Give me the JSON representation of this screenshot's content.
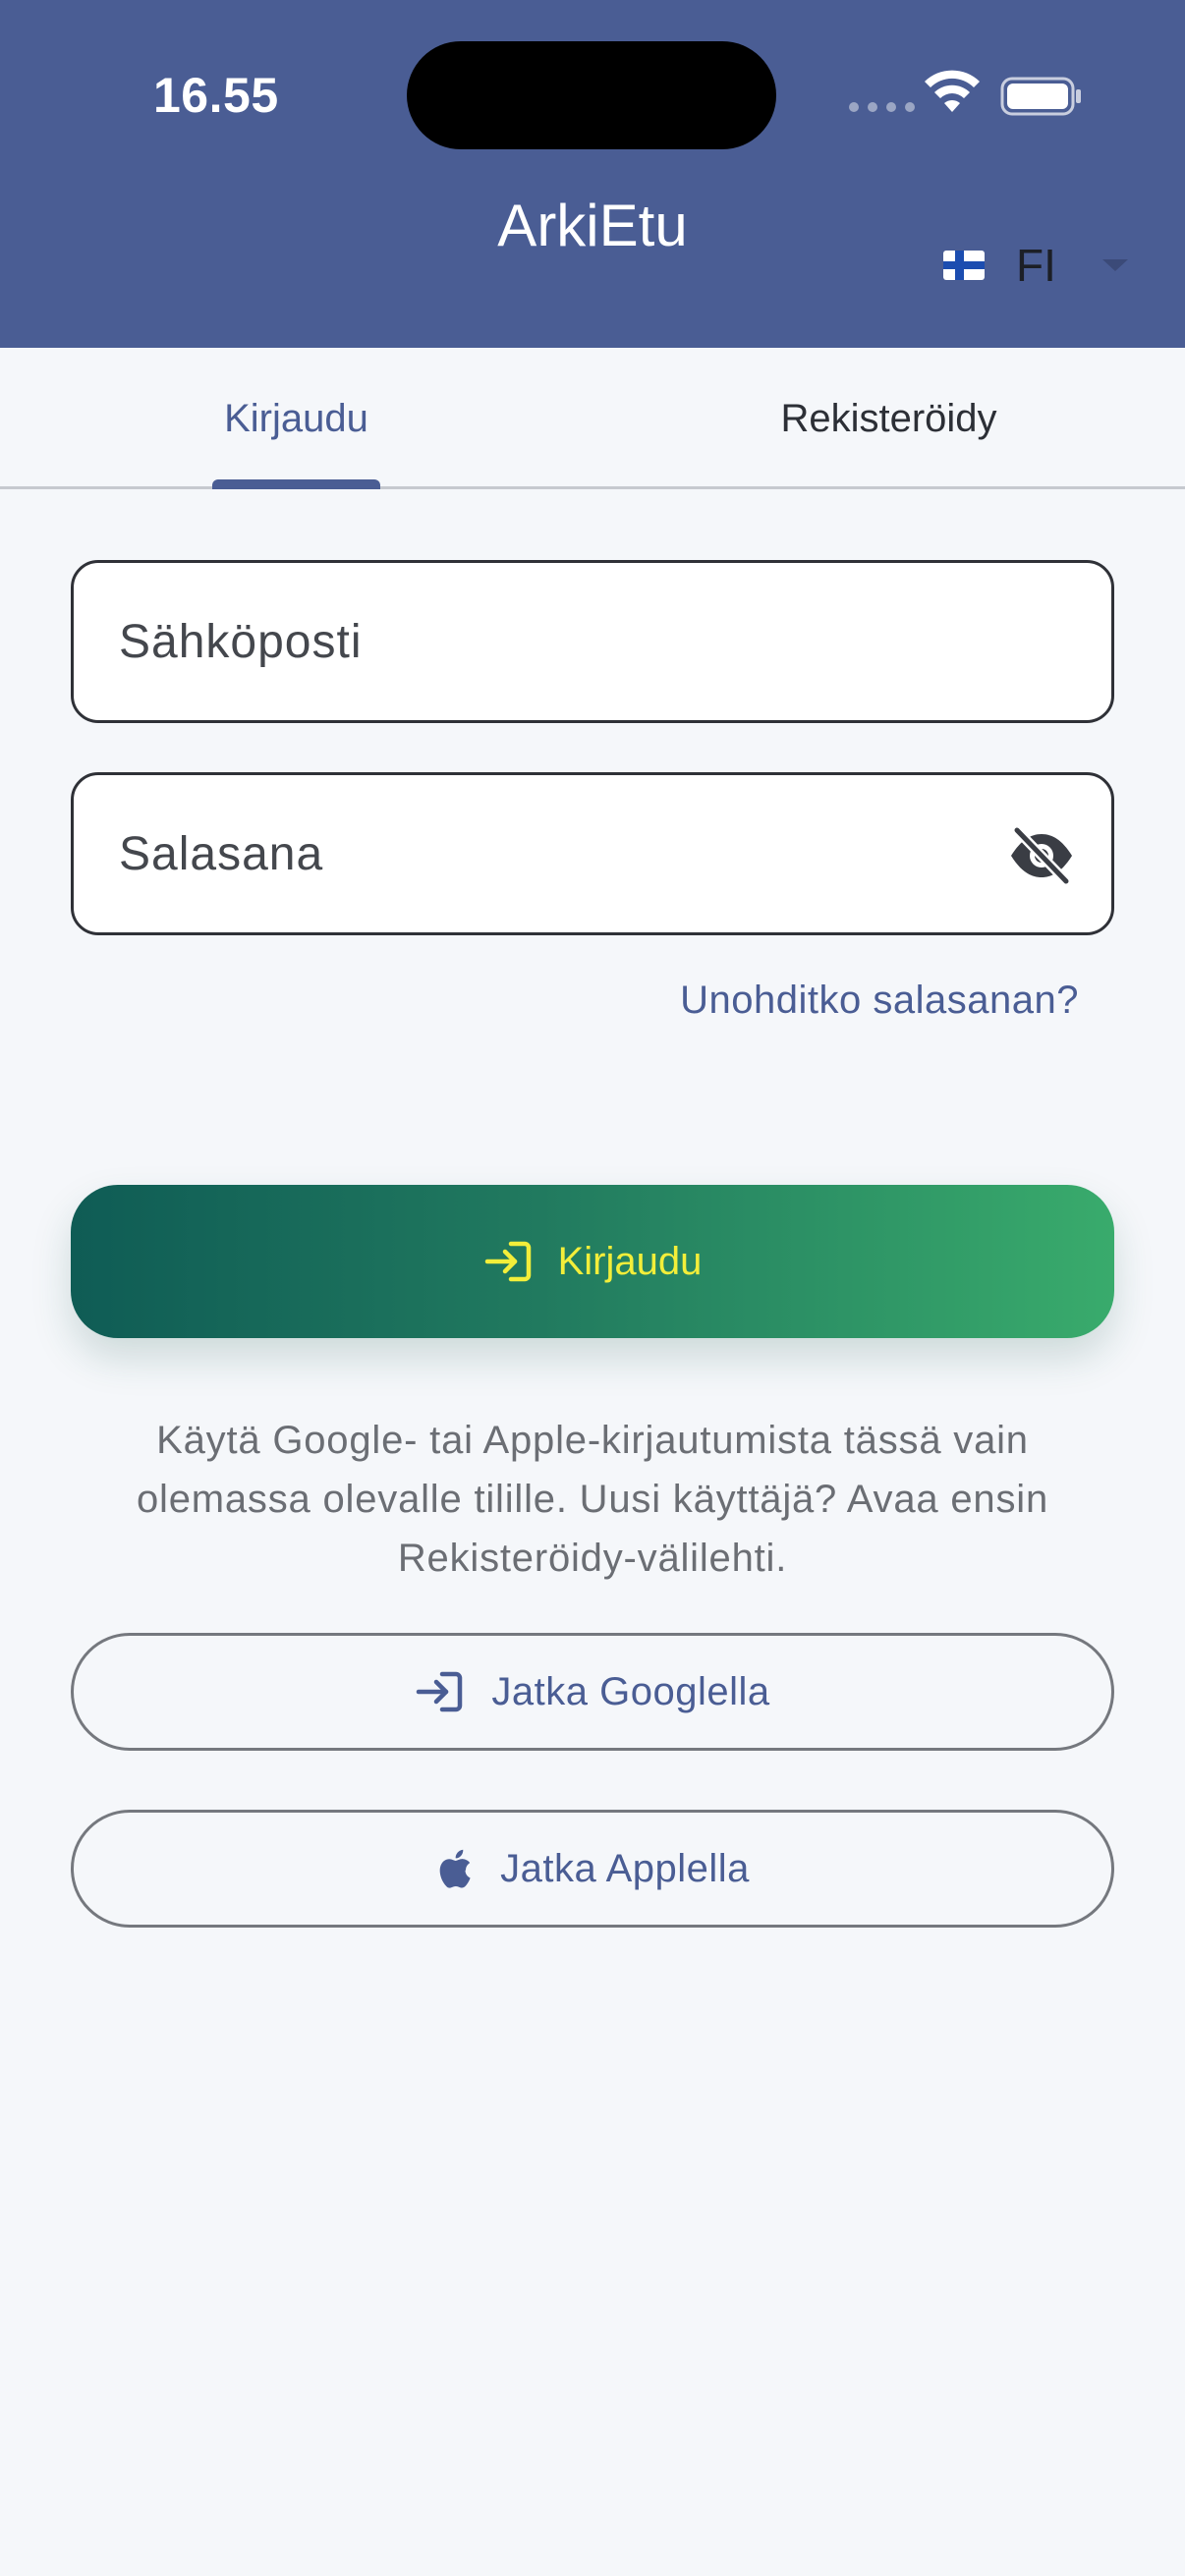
{
  "status_bar": {
    "time": "16.55"
  },
  "header": {
    "title": "ArkiEtu",
    "language": {
      "code": "FI",
      "flag": "finland-flag"
    }
  },
  "tabs": [
    {
      "label": "Kirjaudu",
      "active": true
    },
    {
      "label": "Rekisteröidy",
      "active": false
    }
  ],
  "form": {
    "email_placeholder": "Sähköposti",
    "email_value": "",
    "password_placeholder": "Salasana",
    "password_value": "",
    "forgot_label": "Unohditko salasanan?"
  },
  "login_button": {
    "label": "Kirjaudu",
    "icon": "login-icon"
  },
  "social": {
    "info_text": "Käytä Google- tai Apple-kirjautumista tässä vain olemassa olevalle tilille. Uusi käyttäjä? Avaa ensin Rekisteröidy-välilehti.",
    "google_label": "Jatka Googlella",
    "apple_label": "Jatka Applella"
  },
  "colors": {
    "header_bg": "#4a5d94",
    "accent": "#4a5d94",
    "primary_gradient_start": "#0f5c55",
    "primary_gradient_end": "#39ab6c",
    "primary_text": "#f3ee3a"
  }
}
